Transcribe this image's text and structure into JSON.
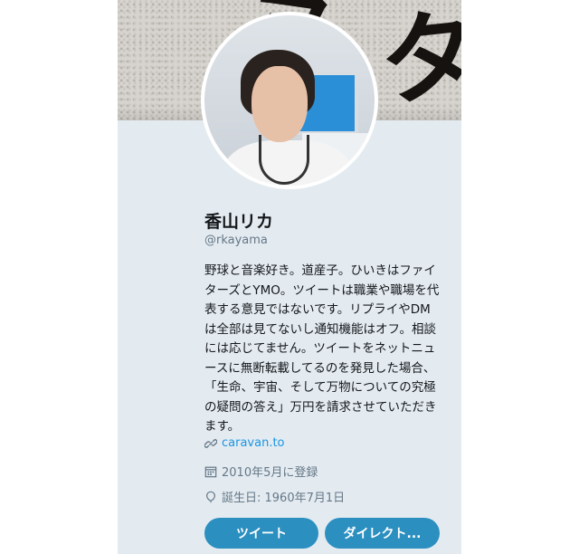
{
  "profile": {
    "name": "香山リカ",
    "handle": "@rkayama",
    "bio": "野球と音楽好き。道産子。ひいきはファイターズとYMO。ツイートは職業や職場を代表する意見ではないです。リプライやDMは全部は見てないし通知機能はオフ。相談には応じてません。ツイートをネットニュースに無断転載してるのを発見した場合、「生命、宇宙、そして万物についての究極の疑問の答え」万円を請求させていただきます。",
    "website": "caravan.to",
    "joined": "2010年5月に登録",
    "birthday": "誕生日: 1960年7月1日"
  },
  "actions": {
    "tweet_label": "ツイート",
    "dm_label": "ダイレクト..."
  },
  "icons": {
    "website": "link-icon",
    "joined": "calendar-icon",
    "birthday": "balloon-icon"
  },
  "colors": {
    "card_bg": "#e3ebf1",
    "button": "#2b8fc0",
    "link": "#1b95e0",
    "muted": "#657786"
  }
}
